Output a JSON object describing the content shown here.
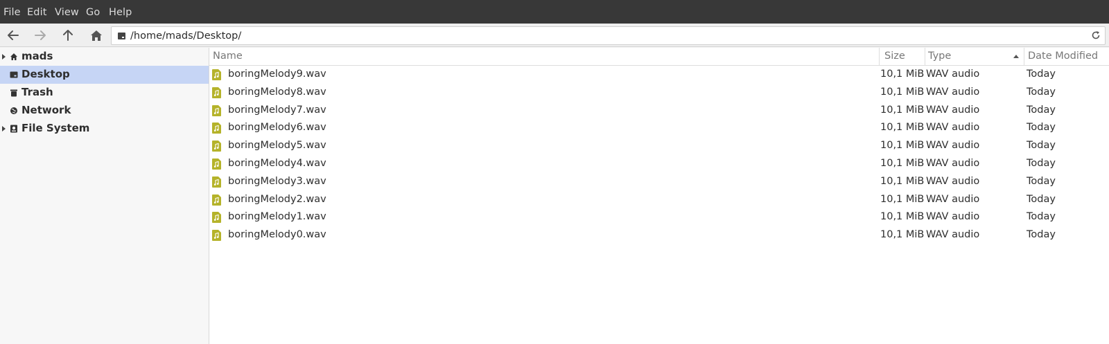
{
  "menubar": {
    "items": [
      "File",
      "Edit",
      "View",
      "Go",
      "Help"
    ]
  },
  "toolbar": {
    "location_path": "/home/mads/Desktop/"
  },
  "sidebar": {
    "items": [
      {
        "label": "mads",
        "icon": "home-icon",
        "expandable": true,
        "selected": false
      },
      {
        "label": "Desktop",
        "icon": "desktop-icon",
        "expandable": false,
        "selected": true
      },
      {
        "label": "Trash",
        "icon": "trash-icon",
        "expandable": false,
        "selected": false
      },
      {
        "label": "Network",
        "icon": "network-icon",
        "expandable": false,
        "selected": false
      },
      {
        "label": "File System",
        "icon": "drive-icon",
        "expandable": true,
        "selected": false
      }
    ]
  },
  "filelist": {
    "columns": [
      "Name",
      "Size",
      "Type",
      "Date Modified"
    ],
    "sorted_by": "Name",
    "rows": [
      {
        "name": "boringMelody9.wav",
        "size": "10,1 MiB",
        "type": "WAV audio",
        "date": "Today"
      },
      {
        "name": "boringMelody8.wav",
        "size": "10,1 MiB",
        "type": "WAV audio",
        "date": "Today"
      },
      {
        "name": "boringMelody7.wav",
        "size": "10,1 MiB",
        "type": "WAV audio",
        "date": "Today"
      },
      {
        "name": "boringMelody6.wav",
        "size": "10,1 MiB",
        "type": "WAV audio",
        "date": "Today"
      },
      {
        "name": "boringMelody5.wav",
        "size": "10,1 MiB",
        "type": "WAV audio",
        "date": "Today"
      },
      {
        "name": "boringMelody4.wav",
        "size": "10,1 MiB",
        "type": "WAV audio",
        "date": "Today"
      },
      {
        "name": "boringMelody3.wav",
        "size": "10,1 MiB",
        "type": "WAV audio",
        "date": "Today"
      },
      {
        "name": "boringMelody2.wav",
        "size": "10,1 MiB",
        "type": "WAV audio",
        "date": "Today"
      },
      {
        "name": "boringMelody1.wav",
        "size": "10,1 MiB",
        "type": "WAV audio",
        "date": "Today"
      },
      {
        "name": "boringMelody0.wav",
        "size": "10,1 MiB",
        "type": "WAV audio",
        "date": "Today"
      }
    ]
  },
  "colors": {
    "menubar_bg": "#383838",
    "selection": "#c6d5f5",
    "audio_icon": "#b5b32a"
  }
}
